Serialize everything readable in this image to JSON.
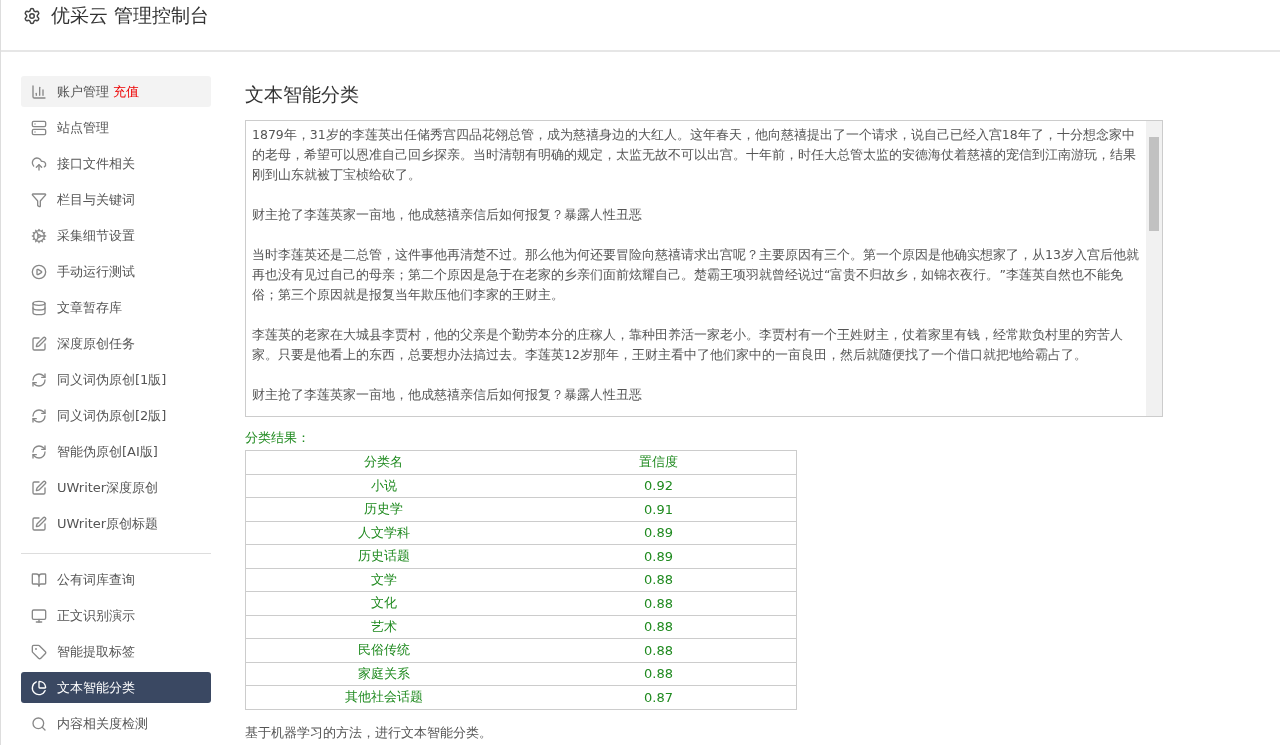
{
  "header": {
    "title": "优采云 管理控制台"
  },
  "sidebar": {
    "groups": [
      {
        "items": [
          {
            "label": "账户管理",
            "badge": "充值",
            "kind": "chart",
            "selected": false,
            "hovered": true
          },
          {
            "label": "站点管理",
            "kind": "server",
            "selected": false,
            "hovered": false
          },
          {
            "label": "接口文件相关",
            "kind": "cloud",
            "selected": false,
            "hovered": false
          },
          {
            "label": "栏目与关键词",
            "kind": "filter",
            "selected": false,
            "hovered": false
          },
          {
            "label": "采集细节设置",
            "kind": "gears",
            "selected": false,
            "hovered": false
          },
          {
            "label": "手动运行测试",
            "kind": "play",
            "selected": false,
            "hovered": false
          },
          {
            "label": "文章暂存库",
            "kind": "database",
            "selected": false,
            "hovered": false
          },
          {
            "label": "深度原创任务",
            "kind": "edit",
            "selected": false,
            "hovered": false
          },
          {
            "label": "同义词伪原创[1版]",
            "kind": "refresh",
            "selected": false,
            "hovered": false
          },
          {
            "label": "同义词伪原创[2版]",
            "kind": "refresh",
            "selected": false,
            "hovered": false
          },
          {
            "label": "智能伪原创[AI版]",
            "kind": "refresh",
            "selected": false,
            "hovered": false
          },
          {
            "label": "UWriter深度原创",
            "kind": "edit",
            "selected": false,
            "hovered": false
          },
          {
            "label": "UWriter原创标题",
            "kind": "edit",
            "selected": false,
            "hovered": false
          }
        ]
      },
      {
        "items": [
          {
            "label": "公有词库查询",
            "kind": "book",
            "selected": false,
            "hovered": false
          },
          {
            "label": "正文识别演示",
            "kind": "monitor",
            "selected": false,
            "hovered": false
          },
          {
            "label": "智能提取标签",
            "kind": "tag",
            "selected": false,
            "hovered": false
          },
          {
            "label": "文本智能分类",
            "kind": "pie",
            "selected": true,
            "hovered": false
          },
          {
            "label": "内容相关度检测",
            "kind": "search",
            "selected": false,
            "hovered": false
          }
        ]
      }
    ]
  },
  "main": {
    "title": "文本智能分类",
    "text_paragraphs": [
      "1879年，31岁的李莲英出任储秀宫四品花翎总管，成为慈禧身边的大红人。这年春天，他向慈禧提出了一个请求，说自己已经入宫18年了，十分想念家中的老母，希望可以恩准自己回乡探亲。当时清朝有明确的规定，太监无故不可以出宫。十年前，时任大总管太监的安德海仗着慈禧的宠信到江南游玩，结果刚到山东就被丁宝桢给砍了。",
      "财主抢了李莲英家一亩地，他成慈禧亲信后如何报复？暴露人性丑恶",
      "当时李莲英还是二总管，这件事他再清楚不过。那么他为何还要冒险向慈禧请求出宫呢？主要原因有三个。第一个原因是他确实想家了，从13岁入宫后他就再也没有见过自己的母亲；第二个原因是急于在老家的乡亲们面前炫耀自己。楚霸王项羽就曾经说过“富贵不归故乡，如锦衣夜行。”李莲英自然也不能免俗；第三个原因就是报复当年欺压他们李家的王财主。",
      "李莲英的老家在大城县李贾村，他的父亲是个勤劳本分的庄稼人，靠种田养活一家老小。李贾村有一个王姓财主，仗着家里有钱，经常欺负村里的穷苦人家。只要是他看上的东西，总要想办法搞过去。李莲英12岁那年，王财主看中了他们家中的一亩良田，然后就随便找了一个借口就把地给霸占了。",
      "财主抢了李莲英家一亩地，他成慈禧亲信后如何报复？暴露人性丑恶"
    ],
    "result_label": "分类结果：",
    "table": {
      "columns": [
        "分类名",
        "置信度"
      ],
      "rows": [
        [
          "小说",
          "0.92"
        ],
        [
          "历史学",
          "0.91"
        ],
        [
          "人文学科",
          "0.89"
        ],
        [
          "历史话题",
          "0.89"
        ],
        [
          "文学",
          "0.88"
        ],
        [
          "文化",
          "0.88"
        ],
        [
          "艺术",
          "0.88"
        ],
        [
          "民俗传统",
          "0.88"
        ],
        [
          "家庭关系",
          "0.88"
        ],
        [
          "其他社会话题",
          "0.87"
        ]
      ]
    },
    "note": "基于机器学习的方法，进行文本智能分类。"
  }
}
